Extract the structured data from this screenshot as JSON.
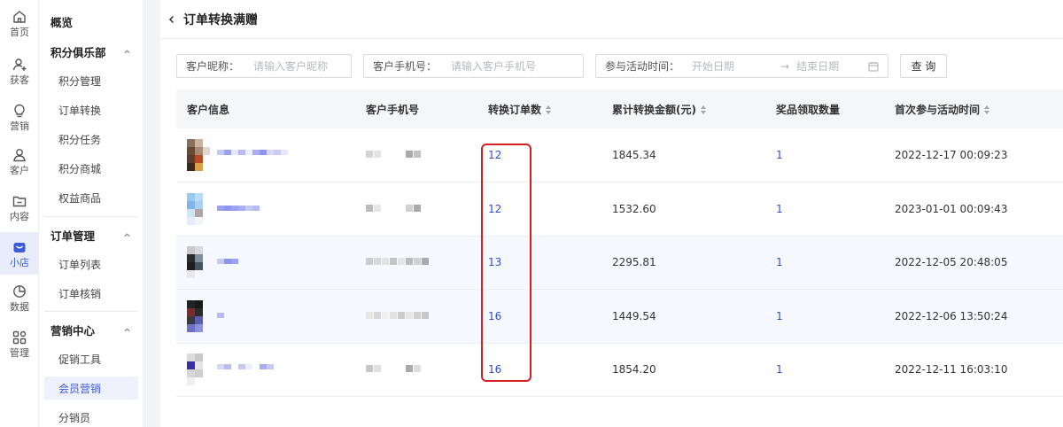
{
  "rail": [
    {
      "label": "首页",
      "icon": "home-icon"
    },
    {
      "label": "获客",
      "icon": "user-add-icon"
    },
    {
      "label": "营销",
      "icon": "bulb-icon"
    },
    {
      "label": "客户",
      "icon": "user-icon"
    },
    {
      "label": "内容",
      "icon": "folder-icon"
    },
    {
      "label": "小店",
      "icon": "shop-icon",
      "active": true
    },
    {
      "label": "数据",
      "icon": "pie-chart-icon"
    },
    {
      "label": "管理",
      "icon": "grid-icon"
    }
  ],
  "subnav": {
    "overview": "概览",
    "groups": [
      {
        "title": "积分俱乐部",
        "items": [
          "积分管理",
          "订单转换",
          "积分任务",
          "积分商城",
          "权益商品"
        ]
      },
      {
        "title": "订单管理",
        "items": [
          "订单列表",
          "订单核销"
        ]
      },
      {
        "title": "营销中心",
        "items": [
          "促销工具",
          "会员营销",
          "分销员"
        ]
      }
    ],
    "active_item": "会员营销"
  },
  "page": {
    "title": "订单转换满赠"
  },
  "filters": {
    "nickname_label": "客户昵称：",
    "nickname_placeholder": "请输入客户昵称",
    "phone_label": "客户手机号：",
    "phone_placeholder": "请输入客户手机号",
    "time_label": "参与活动时间：",
    "start_placeholder": "开始日期",
    "end_placeholder": "结束日期",
    "arrow": "→",
    "query": "查 询"
  },
  "table": {
    "headers": [
      "客户信息",
      "客户手机号",
      "转换订单数",
      "累计转换金额(元)",
      "奖品领取数量",
      "首次参与活动时间"
    ],
    "rows": [
      {
        "orders": "12",
        "amount": "1845.34",
        "prizes": "1",
        "time": "2022-12-17 00:09:23"
      },
      {
        "orders": "12",
        "amount": "1532.60",
        "prizes": "1",
        "time": "2023-01-01 00:09:43"
      },
      {
        "orders": "13",
        "amount": "2295.81",
        "prizes": "1",
        "time": "2022-12-05 20:48:05"
      },
      {
        "orders": "16",
        "amount": "1449.54",
        "prizes": "1",
        "time": "2022-12-06 13:50:24"
      },
      {
        "orders": "16",
        "amount": "1854.20",
        "prizes": "1",
        "time": "2022-12-11 16:03:10"
      }
    ]
  },
  "colors": {
    "accent": "#3b5bdb",
    "link": "#2f4fd0",
    "highlight": "#d62020"
  }
}
